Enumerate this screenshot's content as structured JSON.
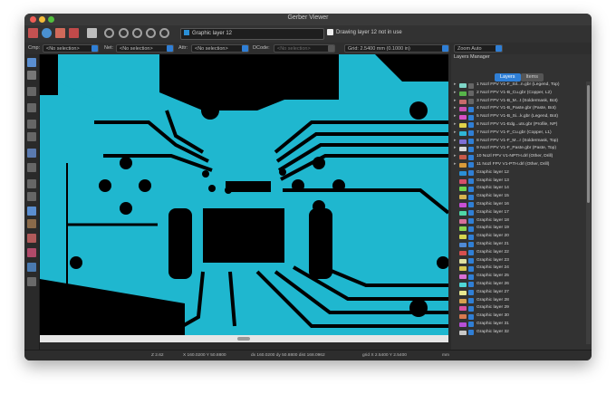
{
  "window": {
    "title": "Gerber Viewer"
  },
  "toolbar": {
    "layer_select": "Graphic layer 12",
    "message": "Drawing layer 12 not in use"
  },
  "filters": {
    "cmp_label": "Cmp:",
    "cmp_value": "<No selection>",
    "net_label": "Net:",
    "net_value": "<No selection>",
    "attr_label": "Attr:",
    "attr_value": "<No selection>",
    "dcode_label": "DCode:",
    "dcode_value": "<No selection>",
    "grid_value": "Grid: 2.5400 mm (0.1000 in)",
    "zoom_value": "Zoom Auto"
  },
  "layers_manager": {
    "title": "Layers Manager",
    "tabs": [
      "Layers",
      "Items"
    ],
    "layers": [
      {
        "name": "1 Nozl FPV V1-F_Sil...n.gbr (Legend, Top)",
        "color": "#7fd6c8",
        "visible": false
      },
      {
        "name": "2 Nozl FPV V1-B_Cu.gbr (Copper, L2)",
        "color": "#57b54a",
        "visible": false
      },
      {
        "name": "3 Nozl FPV V1-B_M...t (Soldermask, Bot)",
        "color": "#c86b6b",
        "visible": false
      },
      {
        "name": "4 Nozl FPV V1-B_Paste.gbr (Paste, Bot)",
        "color": "#c94fb2",
        "visible": true
      },
      {
        "name": "5 Nozl FPV V1-B_Si...k.gbr (Legend, Bot)",
        "color": "#d84fc7",
        "visible": true
      },
      {
        "name": "6 Nozl FPV V1-Edg...uts.gbr (Profile, NP)",
        "color": "#e0d34a",
        "visible": true
      },
      {
        "name": "7 Nozl FPV V1-F_Cu.gbr (Copper, L1)",
        "color": "#2fb6d6",
        "visible": true
      },
      {
        "name": "8 Nozl FPV V1-F_M...r (Soldermask, Top)",
        "color": "#7f6fd6",
        "visible": true
      },
      {
        "name": "9 Nozl FPV V1-F_Paste.gbr (Paste, Top)",
        "color": "#d8d8d8",
        "visible": true
      },
      {
        "name": "10 Nozl FPV V1-NPTH.drl (Other, Drill)",
        "color": "#c85a4a",
        "visible": true
      },
      {
        "name": "11 Nozl FPV V1-PTH.drl (Other, Drill)",
        "color": "#d89a3a",
        "visible": true
      },
      {
        "name": "Graphic layer 12",
        "color": "#2a8fd6",
        "visible": true
      },
      {
        "name": "Graphic layer 13",
        "color": "#d84f6a",
        "visible": true
      },
      {
        "name": "Graphic layer 14",
        "color": "#6fd64f",
        "visible": true
      },
      {
        "name": "Graphic layer 15",
        "color": "#d8b44f",
        "visible": true
      },
      {
        "name": "Graphic layer 16",
        "color": "#c84fd6",
        "visible": true
      },
      {
        "name": "Graphic layer 17",
        "color": "#4fd6a8",
        "visible": true
      },
      {
        "name": "Graphic layer 18",
        "color": "#d86f9a",
        "visible": true
      },
      {
        "name": "Graphic layer 19",
        "color": "#8ad64f",
        "visible": true
      },
      {
        "name": "Graphic layer 20",
        "color": "#d6d64f",
        "visible": true
      },
      {
        "name": "Graphic layer 21",
        "color": "#4f8ad6",
        "visible": true
      },
      {
        "name": "Graphic layer 22",
        "color": "#d64f4f",
        "visible": true
      },
      {
        "name": "Graphic layer 23",
        "color": "#e0e0a0",
        "visible": true
      },
      {
        "name": "Graphic layer 24",
        "color": "#d8c84f",
        "visible": true
      },
      {
        "name": "Graphic layer 25",
        "color": "#d86fd6",
        "visible": true
      },
      {
        "name": "Graphic layer 26",
        "color": "#4fd6d6",
        "visible": true
      },
      {
        "name": "Graphic layer 27",
        "color": "#e8e890",
        "visible": true
      },
      {
        "name": "Graphic layer 28",
        "color": "#d8a04f",
        "visible": true
      },
      {
        "name": "Graphic layer 29",
        "color": "#d84fa0",
        "visible": true
      },
      {
        "name": "Graphic layer 30",
        "color": "#d87a4f",
        "visible": true
      },
      {
        "name": "Graphic layer 31",
        "color": "#b84fd6",
        "visible": true
      },
      {
        "name": "Graphic layer 32",
        "color": "#c8c8c8",
        "visible": true
      }
    ]
  },
  "status": {
    "zoom": "Z 2.62",
    "xy": "X 160.0200  Y 50.8800",
    "dxy": "dx 160.0200  dy 50.8800  dist 168.0962",
    "grid": "grid X 2.5400  Y 2.5400",
    "units": "mm"
  }
}
